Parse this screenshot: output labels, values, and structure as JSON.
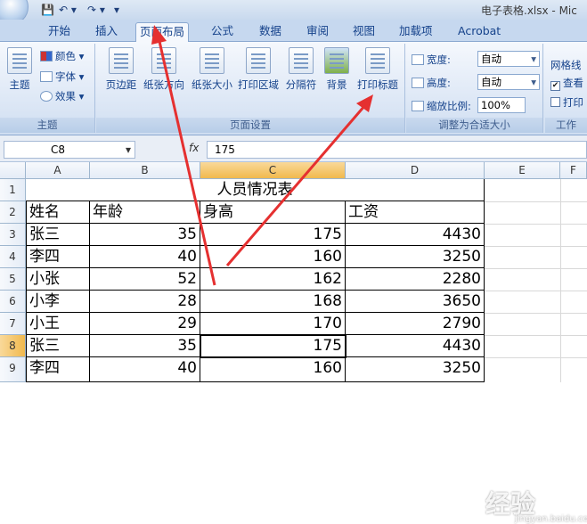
{
  "title": "电子表格.xlsx - Mic",
  "tabs": [
    "开始",
    "插入",
    "页面布局",
    "公式",
    "数据",
    "审阅",
    "视图",
    "加载项",
    "Acrobat"
  ],
  "active_tab": "页面布局",
  "ribbon": {
    "theme": {
      "title": "主题",
      "big": "主题",
      "items": [
        "颜色",
        "字体",
        "效果"
      ]
    },
    "page_setup": {
      "title": "页面设置",
      "buttons": [
        "页边距",
        "纸张方向",
        "纸张大小",
        "打印区域",
        "分隔符",
        "背景",
        "打印标题"
      ]
    },
    "scale": {
      "title": "调整为合适大小",
      "width_label": "宽度:",
      "width_value": "自动",
      "height_label": "高度:",
      "height_value": "自动",
      "zoom_label": "缩放比例:",
      "zoom_value": "100%"
    },
    "sheet_options": {
      "title": "工作",
      "gridlines": "网格线",
      "view": "查看",
      "print": "打印"
    }
  },
  "formula_bar": {
    "name_box": "C8",
    "fx": "fx",
    "value": "175"
  },
  "columns": [
    "A",
    "B",
    "C",
    "D",
    "E",
    "F"
  ],
  "rows": [
    "1",
    "2",
    "3",
    "4",
    "5",
    "6",
    "7",
    "8",
    "9"
  ],
  "sheet": {
    "title": "人员情况表",
    "headers": [
      "姓名",
      "年龄",
      "身高",
      "工资"
    ],
    "data": [
      [
        "张三",
        "35",
        "175",
        "4430"
      ],
      [
        "李四",
        "40",
        "160",
        "3250"
      ],
      [
        "小张",
        "52",
        "162",
        "2280"
      ],
      [
        "小李",
        "28",
        "168",
        "3650"
      ],
      [
        "小王",
        "29",
        "170",
        "2790"
      ],
      [
        "张三",
        "35",
        "175",
        "4430"
      ],
      [
        "李四",
        "40",
        "160",
        "3250"
      ]
    ]
  },
  "watermark": "经验",
  "watermark_sub": "jingyan.baidu.com",
  "colors": {
    "accent": "#e53030",
    "selected_header": "#f1b94d"
  }
}
